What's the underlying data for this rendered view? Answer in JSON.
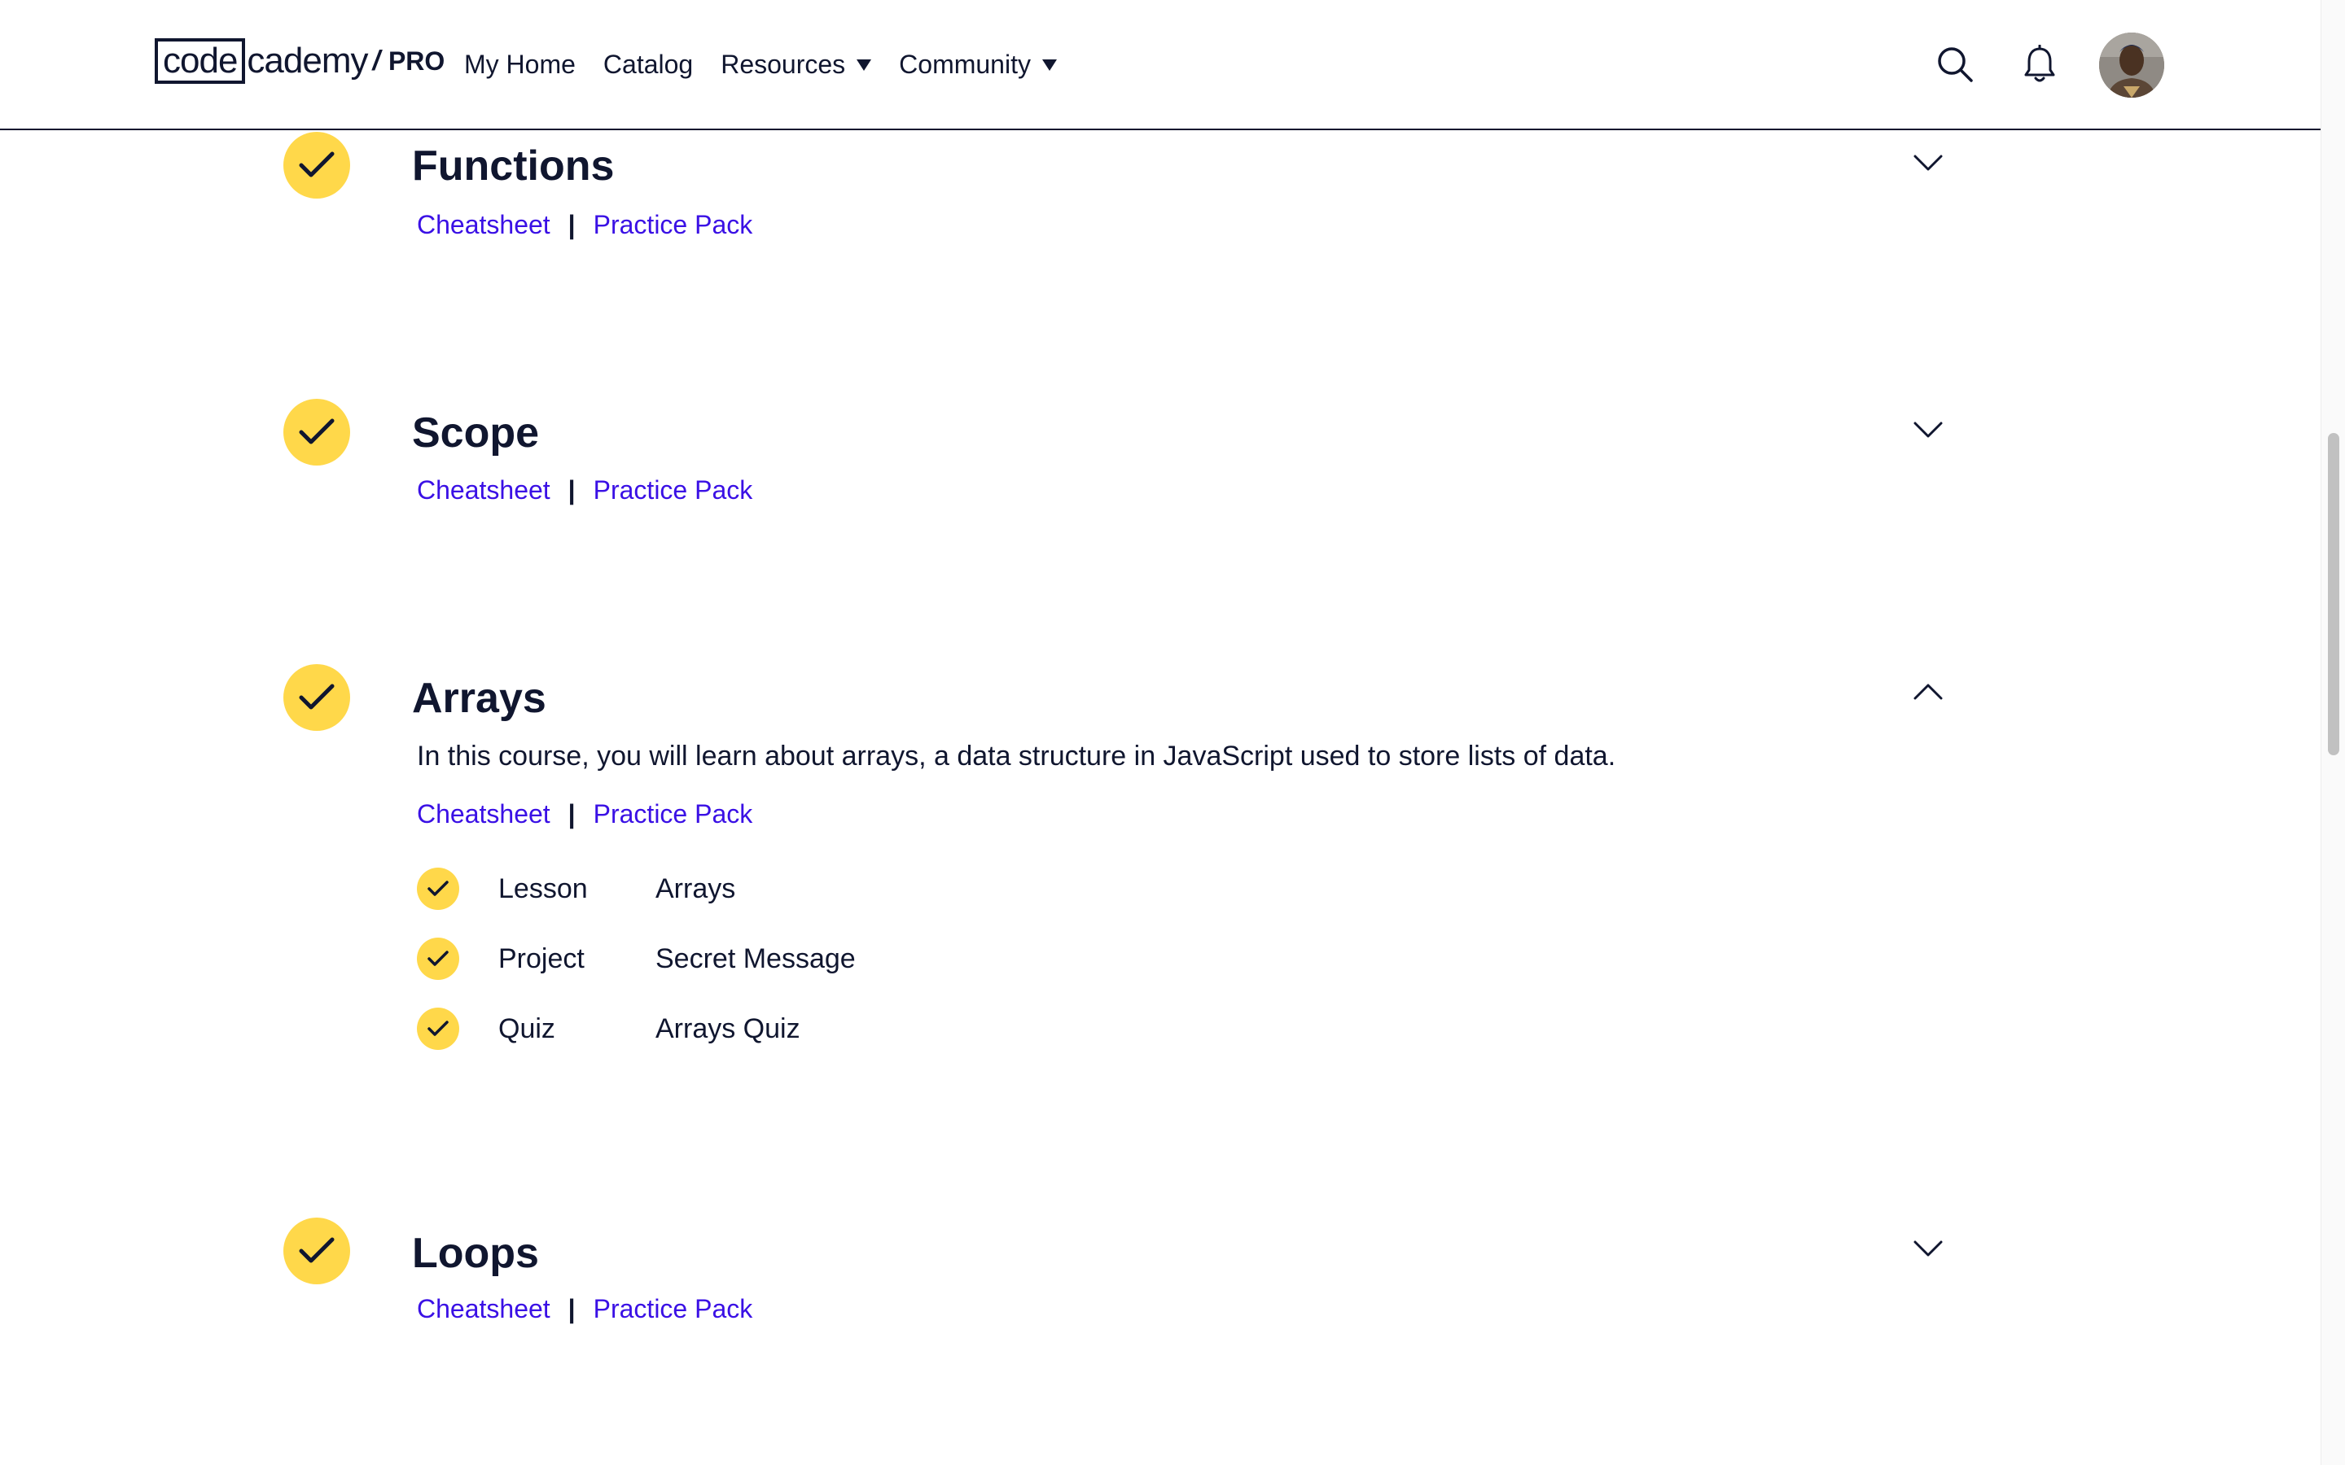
{
  "header": {
    "logo": {
      "part1": "code",
      "part2": "cademy",
      "slash": "/",
      "pro": "PRO"
    },
    "nav": {
      "my_home": "My Home",
      "catalog": "Catalog",
      "resources": "Resources",
      "community": "Community"
    },
    "icons": {
      "search": "search-icon",
      "notifications": "bell-icon",
      "avatar": "user-avatar"
    }
  },
  "modules": [
    {
      "title": "Functions",
      "completed": true,
      "expanded": false,
      "cheatsheet_label": "Cheatsheet",
      "separator": "|",
      "practice_label": "Practice Pack"
    },
    {
      "title": "Scope",
      "completed": true,
      "expanded": false,
      "cheatsheet_label": "Cheatsheet",
      "separator": "|",
      "practice_label": "Practice Pack"
    },
    {
      "title": "Arrays",
      "completed": true,
      "expanded": true,
      "description": "In this course, you will learn about arrays, a data structure in JavaScript used to store lists of data.",
      "cheatsheet_label": "Cheatsheet",
      "separator": "|",
      "practice_label": "Practice Pack",
      "content": [
        {
          "type": "Lesson",
          "name": "Arrays",
          "completed": true
        },
        {
          "type": "Project",
          "name": "Secret Message",
          "completed": true
        },
        {
          "type": "Quiz",
          "name": "Arrays Quiz",
          "completed": true
        }
      ]
    },
    {
      "title": "Loops",
      "completed": true,
      "expanded": false,
      "cheatsheet_label": "Cheatsheet",
      "separator": "|",
      "practice_label": "Practice Pack"
    }
  ],
  "colors": {
    "accent_yellow": "#ffd84a",
    "link_purple": "#3a10e5",
    "navy": "#10162f"
  }
}
